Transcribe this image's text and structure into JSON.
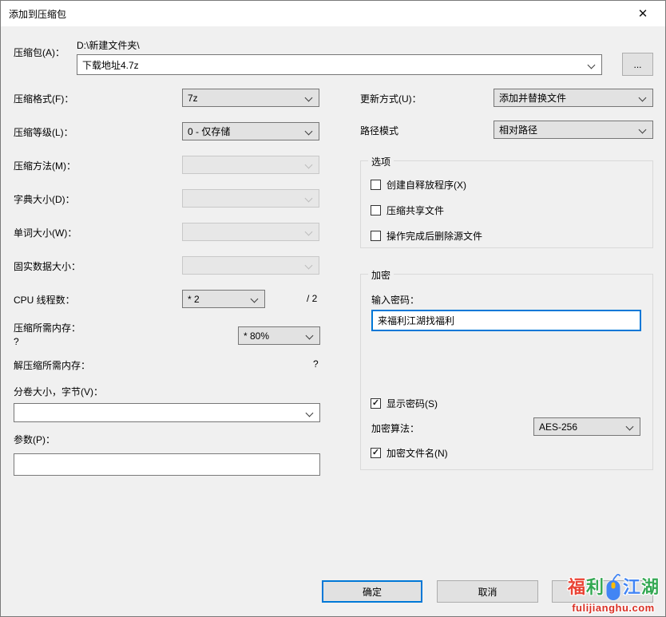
{
  "window": {
    "title": "添加到压缩包"
  },
  "icons": {
    "close": "✕",
    "browse": "..."
  },
  "archive": {
    "label": "压缩包(A)：",
    "dir": "D:\\新建文件夹\\",
    "name": "下载地址4.7z"
  },
  "left_fields": [
    {
      "label": "压缩格式(F)：",
      "value": "7z"
    },
    {
      "label": "压缩等级(L)：",
      "value": "0 - 仅存储"
    },
    {
      "label": "压缩方法(M)：",
      "value": ""
    },
    {
      "label": "字典大小(D)：",
      "value": ""
    },
    {
      "label": "单词大小(W)：",
      "value": ""
    },
    {
      "label": "固实数据大小：",
      "value": ""
    },
    {
      "label": "CPU 线程数：",
      "value": "* 2",
      "suffix": "/ 2"
    }
  ],
  "memory": {
    "label": "压缩所需内存：",
    "unknown": "?",
    "value": "* 80%"
  },
  "decompress": {
    "label": "解压缩所需内存：",
    "unknown": "?"
  },
  "volume": {
    "label": "分卷大小，字节(V)：",
    "value": ""
  },
  "params": {
    "label": "参数(P)：",
    "value": ""
  },
  "update_mode": {
    "label": "更新方式(U)：",
    "value": "添加并替换文件"
  },
  "path_mode": {
    "label": "路径模式",
    "value": "相对路径"
  },
  "options": {
    "title": "选项",
    "items": [
      {
        "label": "创建自释放程序(X)",
        "mark": ""
      },
      {
        "label": "压缩共享文件",
        "mark": ""
      },
      {
        "label": "操作完成后删除源文件",
        "mark": ""
      }
    ]
  },
  "encryption": {
    "title": "加密",
    "password_label": "输入密码：",
    "password_value": "来福利江湖找福利",
    "show_password": {
      "label": "显示密码(S)",
      "mark": "✓"
    },
    "method_label": "加密算法：",
    "method_value": "AES-256",
    "encrypt_names": {
      "label": "加密文件名(N)",
      "mark": "✓"
    }
  },
  "buttons": {
    "ok": "确定",
    "cancel": "取消",
    "help": ""
  },
  "watermark": {
    "chars": [
      "福",
      "利",
      "江",
      "湖"
    ],
    "site": "fulijianghu.com",
    "colors": {
      "red": "#ea4335",
      "green": "#34a853",
      "blue": "#4285f4",
      "yellow": "#fbbc05",
      "site_text": "#d93025"
    }
  },
  "colors": {
    "accent": "#0078d7",
    "dialog_bg": "#f0f0f0",
    "titlebar_bg": "#ffffff"
  }
}
